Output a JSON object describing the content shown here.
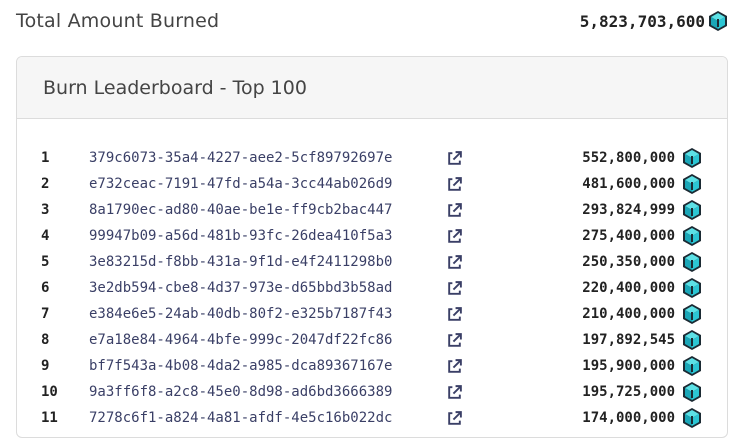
{
  "total": {
    "label": "Total Amount Burned",
    "value": "5,823,703,600",
    "icon": "token-coin-icon"
  },
  "leaderboard": {
    "title": "Burn Leaderboard - Top 100",
    "link_icon": "external-link-icon",
    "coin_icon": "token-coin-icon",
    "rows": [
      {
        "rank": "1",
        "address": "379c6073-35a4-4227-aee2-5cf89792697e",
        "amount": "552,800,000"
      },
      {
        "rank": "2",
        "address": "e732ceac-7191-47fd-a54a-3cc44ab026d9",
        "amount": "481,600,000"
      },
      {
        "rank": "3",
        "address": "8a1790ec-ad80-40ae-be1e-ff9cb2bac447",
        "amount": "293,824,999"
      },
      {
        "rank": "4",
        "address": "99947b09-a56d-481b-93fc-26dea410f5a3",
        "amount": "275,400,000"
      },
      {
        "rank": "5",
        "address": "3e83215d-f8bb-431a-9f1d-e4f2411298b0",
        "amount": "250,350,000"
      },
      {
        "rank": "6",
        "address": "3e2db594-cbe8-4d37-973e-d65bbd3b58ad",
        "amount": "220,400,000"
      },
      {
        "rank": "7",
        "address": "e384e6e5-24ab-40db-80f2-e325b7187f43",
        "amount": "210,400,000"
      },
      {
        "rank": "8",
        "address": "e7a18e84-4964-4bfe-999c-2047df22fc86",
        "amount": "197,892,545"
      },
      {
        "rank": "9",
        "address": "bf7f543a-4b08-4da2-a985-dca89367167e",
        "amount": "195,900,000"
      },
      {
        "rank": "10",
        "address": "9a3ff6f8-a2c8-45e0-8d98-ad6bd3666389",
        "amount": "195,725,000"
      },
      {
        "rank": "11",
        "address": "7278c6f1-a824-4a81-afdf-4e5c16b022dc",
        "amount": "174,000,000"
      }
    ]
  },
  "colors": {
    "coin_top": "#5ce1e6",
    "coin_side": "#1aa7b8",
    "coin_dark": "#1b2a33",
    "link": "#3a3f66"
  }
}
